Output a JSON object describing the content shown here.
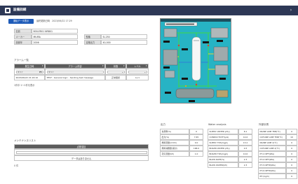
{
  "header": {
    "title": "設備詳細"
  },
  "toolbar": {
    "data_button": "運転データ表示",
    "updated_label": "最終更新日時",
    "updated_value": "2023/06/22 17:29"
  },
  "info": {
    "name_label": "名前",
    "name_value": "BOILER01 NRB01",
    "maker_label": "メーカー",
    "maker_value": "MIURA",
    "model_label": "型番",
    "model_value": "SI-250",
    "installed_label": "設置年",
    "installed_value": "2006",
    "capacity_label": "定格出力",
    "capacity_value": "40,000"
  },
  "alarms": {
    "title": "アラーム一覧",
    "columns": [
      "発生日時",
      "アラーム内容",
      "状態",
      "レベル"
    ],
    "filters": {
      "date": "すべて",
      "content": "すべて"
    },
    "rows": [
      {
        "time": "2023/06/22 21:24:10",
        "message": "TEST : General logic - Sending test message",
        "status": "正常復帰",
        "level": "Lv.1"
      }
    ],
    "pagination": "1件中 1〜1件を表示"
  },
  "maintenance": {
    "title": "メンテナンスリスト",
    "column": "点検項目",
    "empty": "データはありません",
    "count": "0 件"
  },
  "metrics": {
    "output": {
      "title": "出力",
      "rows": [
        {
          "label": "負荷率(%)",
          "value": "0"
        },
        {
          "label": "出力(%)",
          "value": "7.65"
        },
        {
          "label": "燃料流量(m3/h)",
          "value": "0.0"
        },
        {
          "label": "燃料消費量(累計)",
          "value": "168.0"
        },
        {
          "label": "蒸気流量(t/h)",
          "value": "1.0"
        }
      ]
    },
    "water": {
      "title": "Water analysis",
      "rows": [
        {
          "label": "SUPPLY WATER pH(-)",
          "value": "8.1"
        },
        {
          "label": "CONDUCTIVITY(μS)",
          "value": "14.6"
        },
        {
          "label": "SUPPLY TDS(mg/L)",
          "value": "13.2"
        },
        {
          "label": "BOILER WATER pH(-)",
          "value": "4.5"
        },
        {
          "label": "BOILER TDS(mg/L)",
          "value": "10.6"
        },
        {
          "label": "BLOW RATE(%)",
          "value": "2.3"
        },
        {
          "label": "BLOW WATER(t/h)",
          "value": "2.3"
        }
      ]
    },
    "external": {
      "title": "外部計測",
      "rows": [
        {
          "label": "INLINE LINE TMP(℃)",
          "value": "0"
        },
        {
          "label": "OUTLINE LINE TMP(℃)",
          "value": "10"
        },
        {
          "label": "INLINE LINE 2(℃)",
          "value": "0"
        },
        {
          "label": "OUTLINE LINE 2(℃)",
          "value": "0"
        },
        {
          "label": "PT.1 DIFF(kPa)",
          "value": "0"
        },
        {
          "label": "PT.2 DIFF(kPa)",
          "value": "0"
        },
        {
          "label": "PT.3 DIFFP(kPa)",
          "value": "0"
        },
        {
          "label": "PT.4 DIFFP(kPa)",
          "value": "0"
        },
        {
          "label": "PH (kg/h)",
          "value": "0"
        }
      ]
    }
  },
  "icons": {
    "header": "equipment-icon",
    "nav": "chevron-right-icon",
    "calendar": "calendar-icon",
    "sort": "sort-icon",
    "dropdown": "chevron-down-icon"
  },
  "colors": {
    "header": "#2d3856",
    "accent": "#1e5bb8",
    "table_header": "#5c5c5c",
    "label_cell": "#e3e3e3",
    "diagram_background": "#27b3c4",
    "diagram_pipe": "#3bd35a",
    "diagram_tank": "#f7f7f7"
  }
}
